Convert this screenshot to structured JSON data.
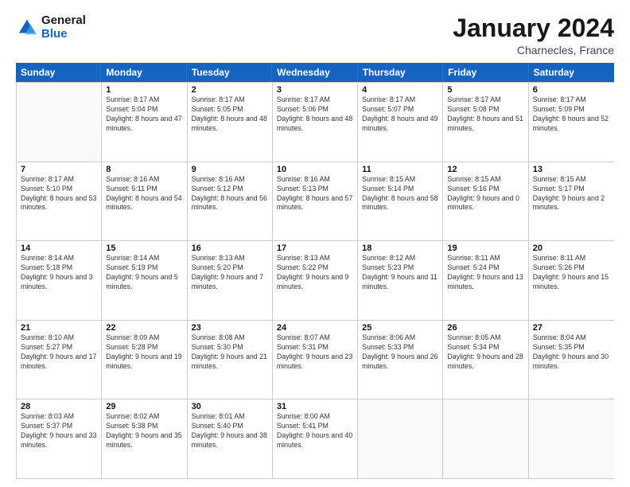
{
  "header": {
    "logo_general": "General",
    "logo_blue": "Blue",
    "month_title": "January 2024",
    "location": "Charnecles, France"
  },
  "weekdays": [
    "Sunday",
    "Monday",
    "Tuesday",
    "Wednesday",
    "Thursday",
    "Friday",
    "Saturday"
  ],
  "rows": [
    [
      {
        "day": "",
        "sunrise": "",
        "sunset": "",
        "daylight": ""
      },
      {
        "day": "1",
        "sunrise": "Sunrise: 8:17 AM",
        "sunset": "Sunset: 5:04 PM",
        "daylight": "Daylight: 8 hours and 47 minutes."
      },
      {
        "day": "2",
        "sunrise": "Sunrise: 8:17 AM",
        "sunset": "Sunset: 5:05 PM",
        "daylight": "Daylight: 8 hours and 48 minutes."
      },
      {
        "day": "3",
        "sunrise": "Sunrise: 8:17 AM",
        "sunset": "Sunset: 5:06 PM",
        "daylight": "Daylight: 8 hours and 48 minutes."
      },
      {
        "day": "4",
        "sunrise": "Sunrise: 8:17 AM",
        "sunset": "Sunset: 5:07 PM",
        "daylight": "Daylight: 8 hours and 49 minutes."
      },
      {
        "day": "5",
        "sunrise": "Sunrise: 8:17 AM",
        "sunset": "Sunset: 5:08 PM",
        "daylight": "Daylight: 8 hours and 51 minutes."
      },
      {
        "day": "6",
        "sunrise": "Sunrise: 8:17 AM",
        "sunset": "Sunset: 5:09 PM",
        "daylight": "Daylight: 8 hours and 52 minutes."
      }
    ],
    [
      {
        "day": "7",
        "sunrise": "Sunrise: 8:17 AM",
        "sunset": "Sunset: 5:10 PM",
        "daylight": "Daylight: 8 hours and 53 minutes."
      },
      {
        "day": "8",
        "sunrise": "Sunrise: 8:16 AM",
        "sunset": "Sunset: 5:11 PM",
        "daylight": "Daylight: 8 hours and 54 minutes."
      },
      {
        "day": "9",
        "sunrise": "Sunrise: 8:16 AM",
        "sunset": "Sunset: 5:12 PM",
        "daylight": "Daylight: 8 hours and 56 minutes."
      },
      {
        "day": "10",
        "sunrise": "Sunrise: 8:16 AM",
        "sunset": "Sunset: 5:13 PM",
        "daylight": "Daylight: 8 hours and 57 minutes."
      },
      {
        "day": "11",
        "sunrise": "Sunrise: 8:15 AM",
        "sunset": "Sunset: 5:14 PM",
        "daylight": "Daylight: 8 hours and 58 minutes."
      },
      {
        "day": "12",
        "sunrise": "Sunrise: 8:15 AM",
        "sunset": "Sunset: 5:16 PM",
        "daylight": "Daylight: 9 hours and 0 minutes."
      },
      {
        "day": "13",
        "sunrise": "Sunrise: 8:15 AM",
        "sunset": "Sunset: 5:17 PM",
        "daylight": "Daylight: 9 hours and 2 minutes."
      }
    ],
    [
      {
        "day": "14",
        "sunrise": "Sunrise: 8:14 AM",
        "sunset": "Sunset: 5:18 PM",
        "daylight": "Daylight: 9 hours and 3 minutes."
      },
      {
        "day": "15",
        "sunrise": "Sunrise: 8:14 AM",
        "sunset": "Sunset: 5:19 PM",
        "daylight": "Daylight: 9 hours and 5 minutes."
      },
      {
        "day": "16",
        "sunrise": "Sunrise: 8:13 AM",
        "sunset": "Sunset: 5:20 PM",
        "daylight": "Daylight: 9 hours and 7 minutes."
      },
      {
        "day": "17",
        "sunrise": "Sunrise: 8:13 AM",
        "sunset": "Sunset: 5:22 PM",
        "daylight": "Daylight: 9 hours and 9 minutes."
      },
      {
        "day": "18",
        "sunrise": "Sunrise: 8:12 AM",
        "sunset": "Sunset: 5:23 PM",
        "daylight": "Daylight: 9 hours and 11 minutes."
      },
      {
        "day": "19",
        "sunrise": "Sunrise: 8:11 AM",
        "sunset": "Sunset: 5:24 PM",
        "daylight": "Daylight: 9 hours and 13 minutes."
      },
      {
        "day": "20",
        "sunrise": "Sunrise: 8:11 AM",
        "sunset": "Sunset: 5:26 PM",
        "daylight": "Daylight: 9 hours and 15 minutes."
      }
    ],
    [
      {
        "day": "21",
        "sunrise": "Sunrise: 8:10 AM",
        "sunset": "Sunset: 5:27 PM",
        "daylight": "Daylight: 9 hours and 17 minutes."
      },
      {
        "day": "22",
        "sunrise": "Sunrise: 8:09 AM",
        "sunset": "Sunset: 5:28 PM",
        "daylight": "Daylight: 9 hours and 19 minutes."
      },
      {
        "day": "23",
        "sunrise": "Sunrise: 8:08 AM",
        "sunset": "Sunset: 5:30 PM",
        "daylight": "Daylight: 9 hours and 21 minutes."
      },
      {
        "day": "24",
        "sunrise": "Sunrise: 8:07 AM",
        "sunset": "Sunset: 5:31 PM",
        "daylight": "Daylight: 9 hours and 23 minutes."
      },
      {
        "day": "25",
        "sunrise": "Sunrise: 8:06 AM",
        "sunset": "Sunset: 5:33 PM",
        "daylight": "Daylight: 9 hours and 26 minutes."
      },
      {
        "day": "26",
        "sunrise": "Sunrise: 8:05 AM",
        "sunset": "Sunset: 5:34 PM",
        "daylight": "Daylight: 9 hours and 28 minutes."
      },
      {
        "day": "27",
        "sunrise": "Sunrise: 8:04 AM",
        "sunset": "Sunset: 5:35 PM",
        "daylight": "Daylight: 9 hours and 30 minutes."
      }
    ],
    [
      {
        "day": "28",
        "sunrise": "Sunrise: 8:03 AM",
        "sunset": "Sunset: 5:37 PM",
        "daylight": "Daylight: 9 hours and 33 minutes."
      },
      {
        "day": "29",
        "sunrise": "Sunrise: 8:02 AM",
        "sunset": "Sunset: 5:38 PM",
        "daylight": "Daylight: 9 hours and 35 minutes."
      },
      {
        "day": "30",
        "sunrise": "Sunrise: 8:01 AM",
        "sunset": "Sunset: 5:40 PM",
        "daylight": "Daylight: 9 hours and 38 minutes."
      },
      {
        "day": "31",
        "sunrise": "Sunrise: 8:00 AM",
        "sunset": "Sunset: 5:41 PM",
        "daylight": "Daylight: 9 hours and 40 minutes."
      },
      {
        "day": "",
        "sunrise": "",
        "sunset": "",
        "daylight": ""
      },
      {
        "day": "",
        "sunrise": "",
        "sunset": "",
        "daylight": ""
      },
      {
        "day": "",
        "sunrise": "",
        "sunset": "",
        "daylight": ""
      }
    ]
  ]
}
